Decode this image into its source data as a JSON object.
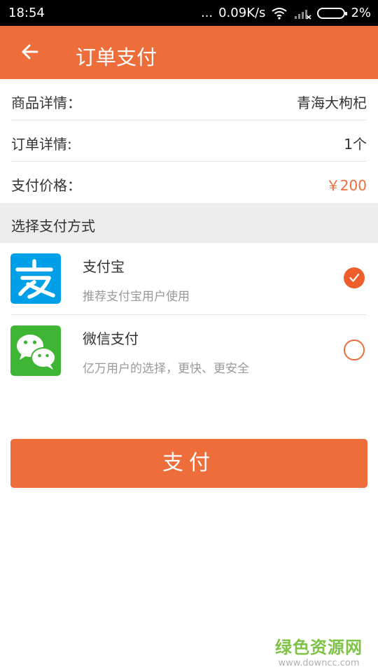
{
  "status_bar": {
    "time": "18:54",
    "dots": "...",
    "net_speed": "0.09K/s",
    "battery": "2%"
  },
  "app_bar": {
    "title": "订单支付",
    "back_icon": "arrow-left-icon"
  },
  "order_info": [
    {
      "label": "商品详情：",
      "value": "青海大枸杞"
    },
    {
      "label": "订单详情:",
      "value": "1个"
    },
    {
      "label": "支付价格：",
      "value": "￥200"
    }
  ],
  "payment_section": {
    "header": "选择支付方式",
    "methods": [
      {
        "name": "支付宝",
        "description": "推荐支付宝用户使用",
        "icon": "alipay-logo",
        "selected": true
      },
      {
        "name": "微信支付",
        "description": "亿万用户的选择，更快、更安全",
        "icon": "wechat-logo",
        "selected": false
      }
    ]
  },
  "pay_button": {
    "label": "支付"
  },
  "watermark": {
    "main": "绿色资源网",
    "sub": "www.downcc.com"
  },
  "colors": {
    "accent": "#ed6d3b",
    "alipay": "#00a0e9",
    "wechat": "#3fb536"
  }
}
